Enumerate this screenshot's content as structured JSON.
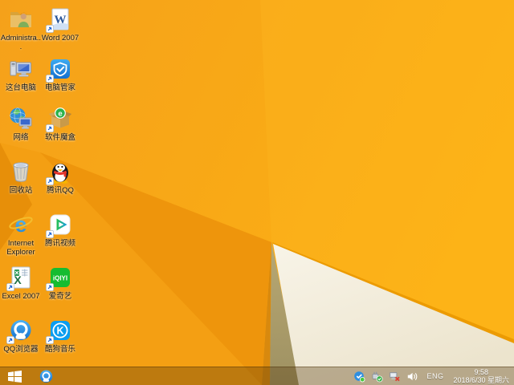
{
  "wallpaper": {
    "base_left": "#f5a11a",
    "base_right": "#fcb013",
    "fold_left": "#f49f13",
    "fold_wedge": "#e78f09",
    "fold_main": "#ee950c",
    "fold_sliver": "#d8890e",
    "khaki_triangle": "#b2a26c",
    "white_triangle": "#f6f2e2",
    "edge_stripe": "#ec9b03"
  },
  "desktop": {
    "icons": [
      {
        "label": "Administra...",
        "icon": "administrator-folder",
        "shortcut": false
      },
      {
        "label": "Word 2007",
        "icon": "word-2007",
        "shortcut": true
      },
      {
        "label": "这台电脑",
        "icon": "this-pc",
        "shortcut": false
      },
      {
        "label": "电脑管家",
        "icon": "pc-manager",
        "shortcut": true
      },
      {
        "label": "网络",
        "icon": "network",
        "shortcut": false
      },
      {
        "label": "软件魔盒",
        "icon": "software-box",
        "shortcut": true
      },
      {
        "label": "回收站",
        "icon": "recycle-bin",
        "shortcut": false
      },
      {
        "label": "腾讯QQ",
        "icon": "tencent-qq",
        "shortcut": true
      },
      {
        "label": "Internet Explorer",
        "icon": "internet-explorer",
        "shortcut": false
      },
      {
        "label": "腾讯视频",
        "icon": "tencent-video",
        "shortcut": true
      },
      {
        "label": "Excel 2007",
        "icon": "excel-2007",
        "shortcut": true
      },
      {
        "label": "爱奇艺",
        "icon": "iqiyi",
        "shortcut": true
      },
      {
        "label": "QQ浏览器",
        "icon": "qq-browser",
        "shortcut": true
      },
      {
        "label": "酷狗音乐",
        "icon": "kugou-music",
        "shortcut": true
      }
    ]
  },
  "taskbar": {
    "pinned": [
      "qq-browser"
    ],
    "tray_icons": [
      "pc-manager-tray",
      "usb-safely-remove",
      "network-disconnected",
      "volume"
    ],
    "language_indicator": "ENG",
    "clock": {
      "time": "9:58",
      "date": "2018/6/30 星期六"
    }
  }
}
